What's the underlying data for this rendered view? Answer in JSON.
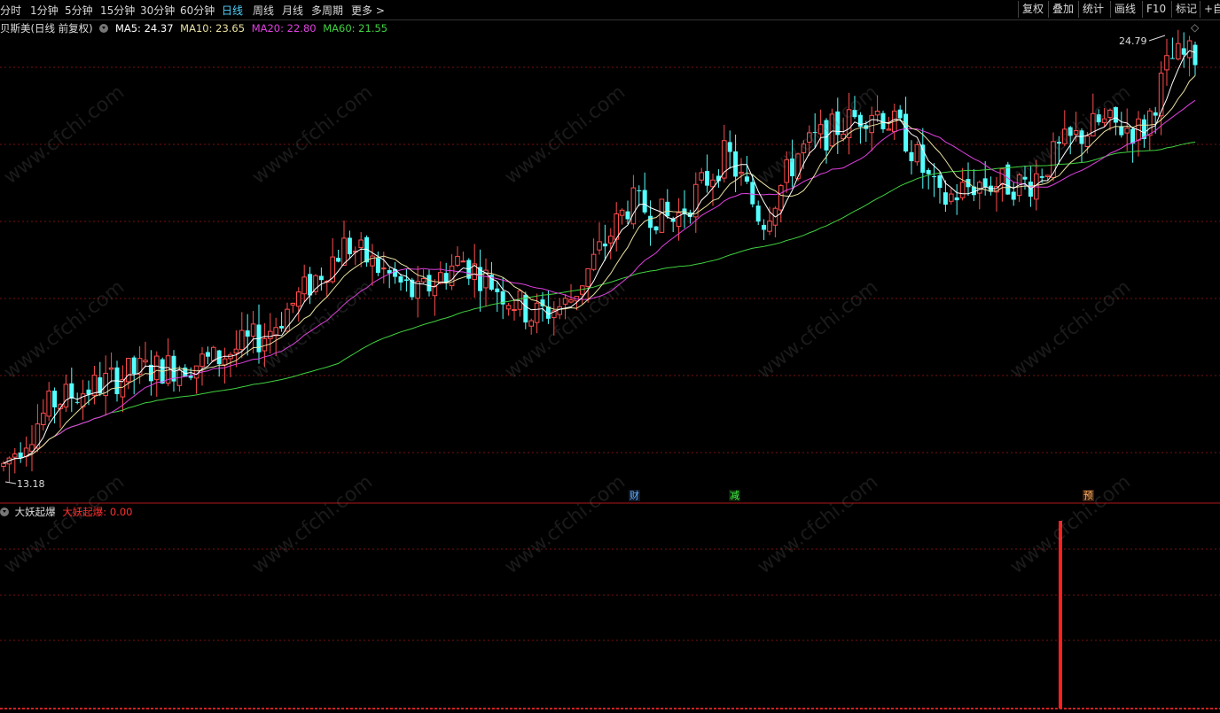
{
  "toolbar": {
    "periods": [
      "分时",
      "1分钟",
      "5分钟",
      "15分钟",
      "30分钟",
      "60分钟",
      "日线",
      "周线",
      "月线",
      "多周期",
      "更多 >"
    ],
    "active_period": "日线",
    "right_buttons": [
      "复权",
      "叠加",
      "统计",
      "画线",
      "F10",
      "标记",
      "+自"
    ]
  },
  "stock_info": {
    "name": "贝斯美(日线 前复权)",
    "ma5": "MA5: 24.37",
    "ma10": "MA10: 23.65",
    "ma20": "MA20: 22.80",
    "ma60": "MA60: 21.55",
    "high_label": "24.79",
    "low_label": "13.18",
    "diamond": "◇"
  },
  "event_tags": [
    "财",
    "减",
    "预"
  ],
  "indicator": {
    "name": "大妖起爆",
    "value_label": "大妖起爆: 0.00"
  },
  "watermark": "www.cfchi.com",
  "colors": {
    "up": "#ff4d4d",
    "down": "#54ffff",
    "ma5": "#ffffff",
    "ma10": "#e8e0a0",
    "ma20": "#e040e0",
    "ma60": "#40d040",
    "signal": "#ff2020",
    "grid": "#7a1010"
  },
  "chart_data": {
    "type": "candlestick",
    "price_range": [
      13.18,
      24.79
    ],
    "series_ma": [
      "MA5",
      "MA10",
      "MA20",
      "MA60"
    ],
    "indicator_signal_index": 136
  }
}
